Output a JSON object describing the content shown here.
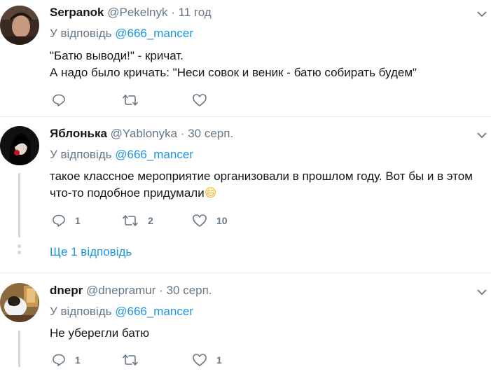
{
  "replying_label": "У відповідь",
  "tweets": [
    {
      "name": "Serpanok",
      "handle": "@Pekelnyk",
      "time": "11 год",
      "reply_to": "@666_mancer",
      "lines": [
        "\"Батю выводи!\" - кричат.",
        "А надо было кричать: \"Неси совок и веник - батю собирать будем\""
      ],
      "counts": {
        "reply": "",
        "retweet": "",
        "like": ""
      }
    },
    {
      "name": "Яблонька",
      "handle": "@Yablonyka",
      "time": "30 серп.",
      "reply_to": "@666_mancer",
      "lines": [
        "такое классное мероприятие организовали в прошлом году. Вот бы и в этом",
        "что-то подобное придумали"
      ],
      "emoji": "😄",
      "counts": {
        "reply": "1",
        "retweet": "2",
        "like": "10"
      },
      "more_replies": "Ще 1 відповідь"
    },
    {
      "name": "dnepr",
      "handle": "@dnepramur",
      "time": "30 серп.",
      "reply_to": "@666_mancer",
      "lines": [
        "Не уберегли батю"
      ],
      "counts": {
        "reply": "1",
        "retweet": "",
        "like": "1"
      }
    }
  ],
  "separator": "·",
  "colors": {
    "text": "#14171a",
    "secondary": "#657786",
    "link": "#1b95e0",
    "divider": "#e6ecf0"
  }
}
